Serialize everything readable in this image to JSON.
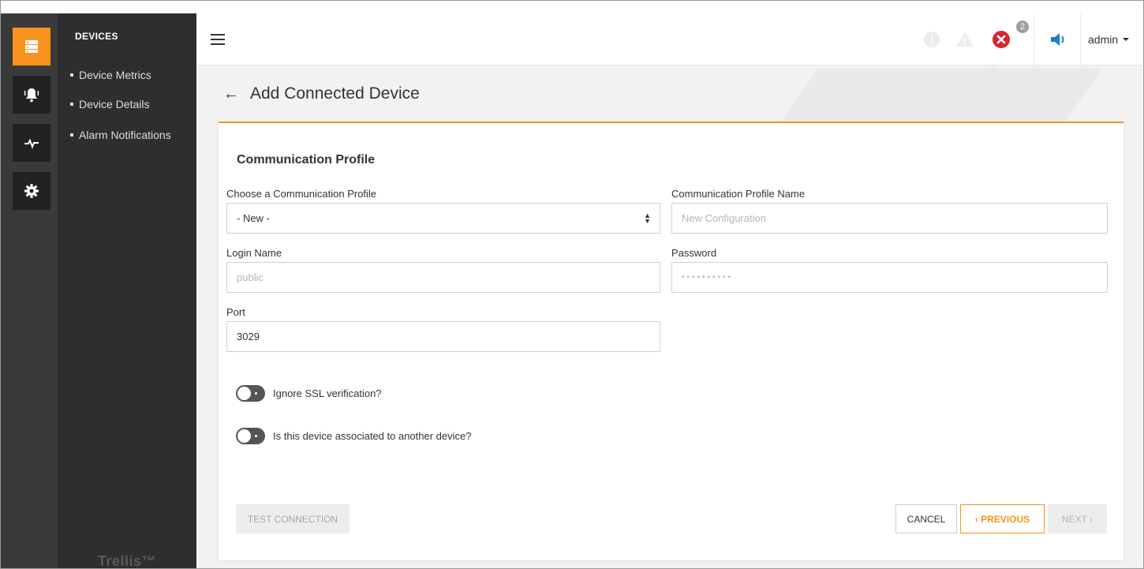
{
  "sidebar": {
    "section_title": "DEVICES",
    "items": [
      {
        "label": "Device Metrics"
      },
      {
        "label": "Device Details"
      },
      {
        "label": "Alarm Notifications"
      }
    ],
    "brand": "Trellis™",
    "rail_icons": [
      "server-icon",
      "bell-icon",
      "pulse-icon",
      "gear-icon"
    ]
  },
  "topbar": {
    "user": "admin",
    "error_count": "2"
  },
  "page": {
    "back_arrow": "←",
    "title": "Add Connected Device"
  },
  "form": {
    "section_title": "Communication Profile",
    "profile_label": "Choose a Communication Profile",
    "profile_value": "- New -",
    "profile_name_label": "Communication Profile Name",
    "profile_name_placeholder": "New Configuration",
    "login_label": "Login Name",
    "login_placeholder": "public",
    "password_label": "Password",
    "password_placeholder": "••••••••••",
    "port_label": "Port",
    "port_value": "3029",
    "ssl_label": "Ignore SSL verification?",
    "assoc_label": "Is this device associated to another device?"
  },
  "buttons": {
    "test": "TEST CONNECTION",
    "cancel": "CANCEL",
    "previous": "‹ PREVIOUS",
    "next": "NEXT ›"
  },
  "colors": {
    "accent": "#f7931e",
    "error": "#d9252c",
    "info": "#1a7fd0",
    "rail": "#3a3a3a",
    "nav": "#2e2e2e"
  }
}
